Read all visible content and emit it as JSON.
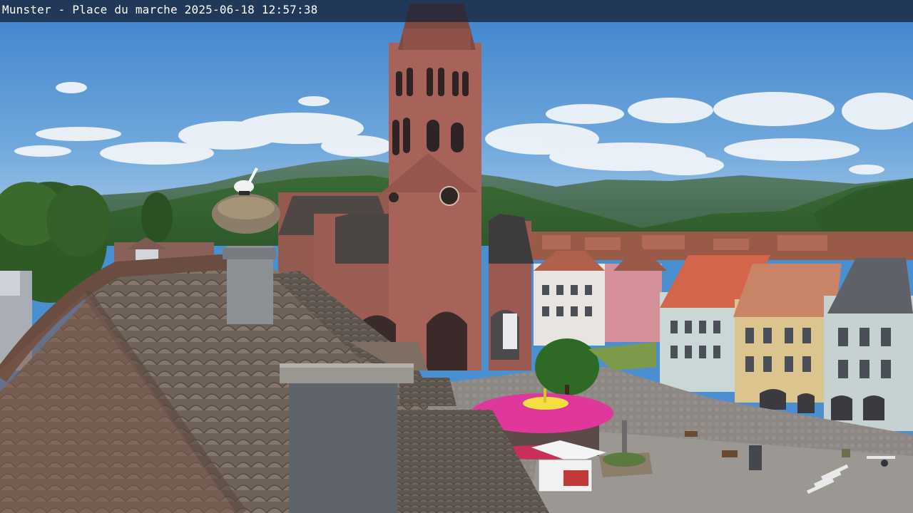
{
  "webcam": {
    "location_label": "Munster - Place du marche",
    "date": "2025-06-18",
    "time": "12:57:38"
  },
  "scene": {
    "description_icons": [
      "church-tower",
      "stork-nest",
      "tiled-roof",
      "carousel-umbrella",
      "townhouses",
      "forested-hills"
    ],
    "colors": {
      "sky": "#4a8fd0",
      "hills": "#3e6b3a",
      "sandstone": "#a7625a",
      "roof_tile": "#7a6a60",
      "umbrella": "#e0389a",
      "square": "#8f8a85"
    }
  }
}
